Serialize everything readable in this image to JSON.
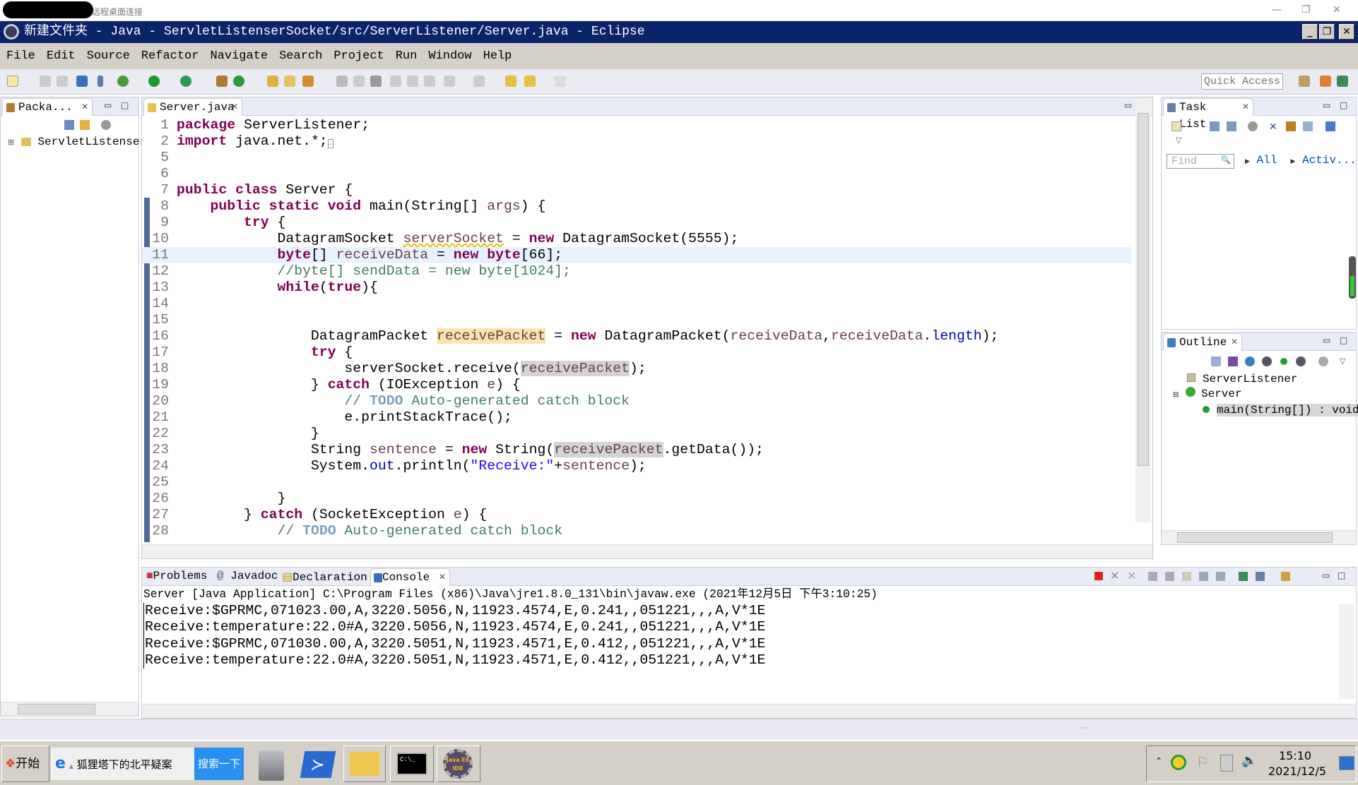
{
  "rdp": {
    "label": "远程桌面连接"
  },
  "window": {
    "title": "新建文件夹 - Java - ServletListenserSocket/src/ServerListener/Server.java - Eclipse"
  },
  "menu": [
    "File",
    "Edit",
    "Source",
    "Refactor",
    "Navigate",
    "Search",
    "Project",
    "Run",
    "Window",
    "Help"
  ],
  "toolbar": {
    "quick_access_placeholder": "Quick Access"
  },
  "package_explorer": {
    "tab": "Packa...",
    "tree": [
      "ServletListenser"
    ]
  },
  "editor": {
    "tab": "Server.java",
    "lines": [
      {
        "n": "1",
        "t": [
          [
            "kw",
            "package"
          ],
          [
            "",
            "ServerListener;"
          ]
        ]
      },
      {
        "n": "2",
        "t": [
          [
            "kw",
            "import"
          ],
          [
            "",
            " java.net.*;"
          ],
          [
            "fold",
            "…"
          ]
        ]
      },
      {
        "n": "5",
        "t": []
      },
      {
        "n": "6",
        "t": []
      },
      {
        "n": "7",
        "t": [
          [
            "kw",
            "public class"
          ],
          [
            "",
            " Server {"
          ]
        ]
      },
      {
        "n": "8",
        "t": [
          [
            "",
            "    "
          ],
          [
            "kw",
            "public static void"
          ],
          [
            "",
            " main(String[] "
          ],
          [
            "var",
            "args"
          ],
          [
            "",
            ") {"
          ]
        ]
      },
      {
        "n": "9",
        "t": [
          [
            "",
            "        "
          ],
          [
            "kw",
            "try"
          ],
          [
            "",
            " {"
          ]
        ]
      },
      {
        "n": "10",
        "t": [
          [
            "",
            "            DatagramSocket "
          ],
          [
            "warn",
            "serverSocket"
          ],
          [
            "",
            " = "
          ],
          [
            "kw",
            "new"
          ],
          [
            "",
            " DatagramSocket(5555);"
          ]
        ]
      },
      {
        "n": "11",
        "cur": true,
        "t": [
          [
            "",
            "            "
          ],
          [
            "kw",
            "byte"
          ],
          [
            "",
            "[] "
          ],
          [
            "var",
            "receiveData"
          ],
          [
            "",
            " = "
          ],
          [
            "kw",
            "new"
          ],
          [
            "",
            " "
          ],
          [
            "kw",
            "byte"
          ],
          [
            "",
            "[66];"
          ]
        ]
      },
      {
        "n": "12",
        "t": [
          [
            "",
            "            "
          ],
          [
            "com",
            "//byte[] sendData = new byte[1024];"
          ]
        ]
      },
      {
        "n": "13",
        "t": [
          [
            "",
            "            "
          ],
          [
            "kw",
            "while"
          ],
          [
            "",
            "("
          ],
          [
            "kw",
            "true"
          ],
          [
            "",
            "){"
          ]
        ]
      },
      {
        "n": "14",
        "t": []
      },
      {
        "n": "15",
        "t": []
      },
      {
        "n": "16",
        "t": [
          [
            "",
            "                DatagramPacket "
          ],
          [
            "hl",
            "receivePacket"
          ],
          [
            "",
            " = "
          ],
          [
            "kw",
            "new"
          ],
          [
            "",
            " DatagramPacket("
          ],
          [
            "var",
            "receiveData"
          ],
          [
            "",
            ","
          ],
          [
            "var",
            "receiveData"
          ],
          [
            "",
            "."
          ],
          [
            "fld",
            "length"
          ],
          [
            "",
            ");"
          ]
        ]
      },
      {
        "n": "17",
        "t": [
          [
            "",
            "                "
          ],
          [
            "kw",
            "try"
          ],
          [
            "",
            " {"
          ]
        ]
      },
      {
        "n": "18",
        "t": [
          [
            "",
            "                    serverSocket.receive("
          ],
          [
            "occ",
            "receivePacket"
          ],
          [
            "",
            ");"
          ]
        ]
      },
      {
        "n": "19",
        "t": [
          [
            "",
            "                } "
          ],
          [
            "kw",
            "catch"
          ],
          [
            "",
            " (IOException "
          ],
          [
            "var",
            "e"
          ],
          [
            "",
            ") {"
          ]
        ]
      },
      {
        "n": "20",
        "t": [
          [
            "",
            "                    "
          ],
          [
            "com",
            "// "
          ],
          [
            "todo",
            "TODO"
          ],
          [
            "com",
            " Auto-generated catch block"
          ]
        ]
      },
      {
        "n": "21",
        "t": [
          [
            "",
            "                    e.printStackTrace();"
          ]
        ]
      },
      {
        "n": "22",
        "t": [
          [
            "",
            "                }"
          ]
        ]
      },
      {
        "n": "23",
        "t": [
          [
            "",
            "                String "
          ],
          [
            "var",
            "sentence"
          ],
          [
            "",
            " = "
          ],
          [
            "kw",
            "new"
          ],
          [
            "",
            " String("
          ],
          [
            "occ",
            "receivePacket"
          ],
          [
            "",
            ".getData());"
          ]
        ]
      },
      {
        "n": "24",
        "t": [
          [
            "",
            "                System."
          ],
          [
            "fld",
            "out"
          ],
          [
            "",
            ".println("
          ],
          [
            "str",
            "\"Receive:\""
          ],
          [
            "",
            "+"
          ],
          [
            "var",
            "sentence"
          ],
          [
            "",
            ");"
          ]
        ]
      },
      {
        "n": "25",
        "t": []
      },
      {
        "n": "26",
        "t": [
          [
            "",
            "            }"
          ]
        ]
      },
      {
        "n": "27",
        "t": [
          [
            "",
            "        } "
          ],
          [
            "kw",
            "catch"
          ],
          [
            "",
            " (SocketException "
          ],
          [
            "var",
            "e"
          ],
          [
            "",
            ") {"
          ]
        ]
      },
      {
        "n": "28",
        "t": [
          [
            "",
            "            "
          ],
          [
            "com",
            "// "
          ],
          [
            "todo",
            "TODO"
          ],
          [
            "com",
            " Auto-generated catch block"
          ]
        ]
      }
    ]
  },
  "task_list": {
    "tab": "Task List",
    "find_placeholder": "Find",
    "links": [
      "All",
      "Activ..."
    ]
  },
  "outline": {
    "tab": "Outline",
    "items": [
      "ServerListener",
      "Server",
      "main(String[]) : void"
    ]
  },
  "bottom_tabs": [
    "Problems",
    "Javadoc",
    "Declaration",
    "Console"
  ],
  "console": {
    "header": "Server [Java Application] C:\\Program Files (x86)\\Java\\jre1.8.0_131\\bin\\javaw.exe (2021年12月5日 下午3:10:25)",
    "lines": [
      "Receive:$GPRMC,071023.00,A,3220.5056,N,11923.4574,E,0.241,,051221,,,A,V*1E",
      "Receive:temperature:22.0#A,3220.5056,N,11923.4574,E,0.241,,051221,,,A,V*1E",
      "Receive:$GPRMC,071030.00,A,3220.5051,N,11923.4571,E,0.412,,051221,,,A,V*1E",
      "Receive:temperature:22.0#A,3220.5051,N,11923.4571,E,0.412,,051221,,,A,V*1E"
    ]
  },
  "taskbar": {
    "start": "开始",
    "search_text": "狐狸塔下的北平疑案",
    "search_button": "搜索一下",
    "app_label": "Java EE IDE",
    "time": "15:10",
    "date": "2021/12/5"
  }
}
